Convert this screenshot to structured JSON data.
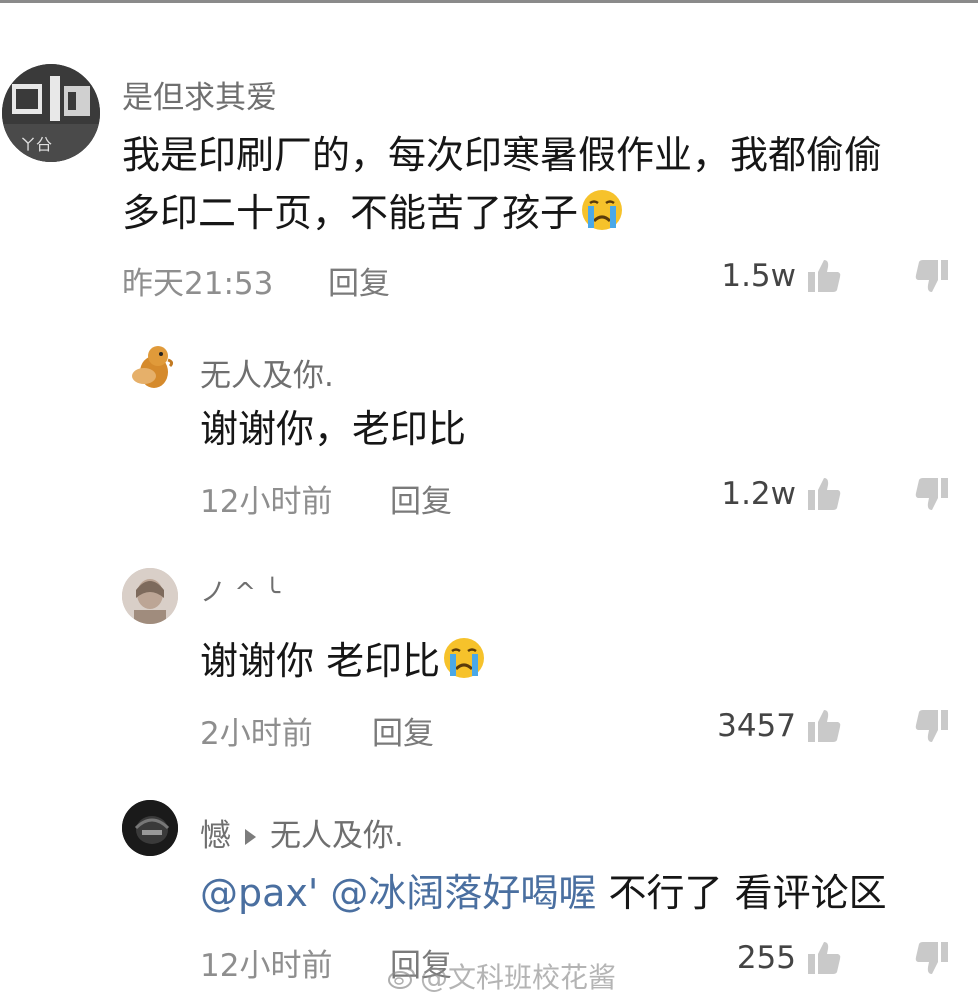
{
  "comments": [
    {
      "username": "是但求其爱",
      "text_line1": "我是印刷厂的，每次印寒暑假作业，我都偷偷",
      "text_line2": "多印二十页，不能苦了孩子",
      "time": "昨天21:53",
      "reply": "回复",
      "likes": "1.5w",
      "emoji": "crying-face"
    },
    {
      "username": "无人及你.",
      "text": "谢谢你，老印比",
      "time": "12小时前",
      "reply": "回复",
      "likes": "1.2w"
    },
    {
      "username": "ノ ^ ╰",
      "text": "谢谢你 老印比",
      "time": "2小时前",
      "reply": "回复",
      "likes": "3457",
      "emoji": "crying-face"
    },
    {
      "username": "憾",
      "reply_to": "无人及你.",
      "mention": "@pax' @冰阔落好喝喔",
      "text": " 不行了 看评论区",
      "time": "12小时前",
      "reply": "回复",
      "likes": "255"
    }
  ],
  "watermark": "@文科班校花酱",
  "colors": {
    "mention": "#4a6fa0",
    "meta": "#8e8e8e",
    "username": "#6f6f6f",
    "emoji_face": "#f6c22b",
    "emoji_tear": "#4aa8e8"
  }
}
